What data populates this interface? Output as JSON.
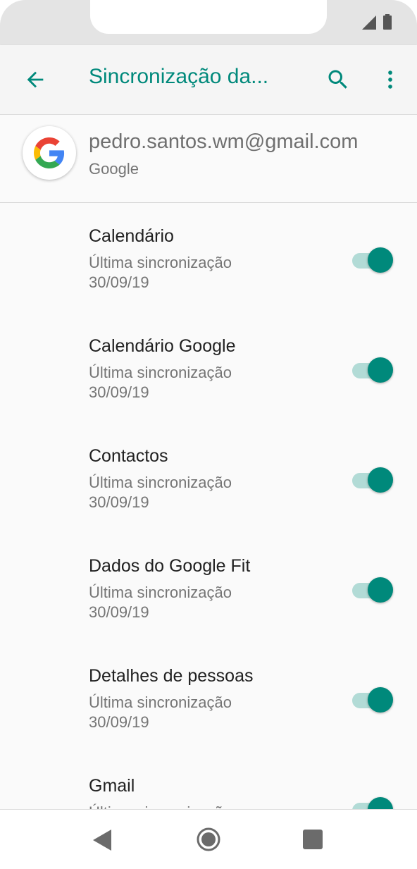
{
  "status_bar": {
    "signal_icon": "signal-icon",
    "battery_icon": "battery-icon"
  },
  "toolbar": {
    "title": "Sincronização da...",
    "back_icon": "arrow-back-icon",
    "search_icon": "search-icon",
    "more_icon": "more-vert-icon",
    "accent_color": "#00897b"
  },
  "account": {
    "email": "pedro.santos.wm@gmail.com",
    "type": "Google",
    "icon": "google-logo-icon"
  },
  "sync_items": [
    {
      "title": "Calendário",
      "subtitle_line1": "Última sincronização",
      "subtitle_line2": "30/09/19",
      "enabled": true
    },
    {
      "title": "Calendário Google",
      "subtitle_line1": "Última sincronização",
      "subtitle_line2": "30/09/19",
      "enabled": true
    },
    {
      "title": "Contactos",
      "subtitle_line1": "Última sincronização",
      "subtitle_line2": "30/09/19",
      "enabled": true
    },
    {
      "title": "Dados do Google Fit",
      "subtitle_line1": "Última sincronização",
      "subtitle_line2": "30/09/19",
      "enabled": true
    },
    {
      "title": "Detalhes de pessoas",
      "subtitle_line1": "Última sincronização",
      "subtitle_line2": "30/09/19",
      "enabled": true
    },
    {
      "title": "Gmail",
      "subtitle_line1": "Última sincronização",
      "subtitle_line2": "",
      "enabled": true
    }
  ],
  "nav_bar": {
    "back_icon": "nav-back-icon",
    "home_icon": "nav-home-icon",
    "recents_icon": "nav-recents-icon"
  }
}
